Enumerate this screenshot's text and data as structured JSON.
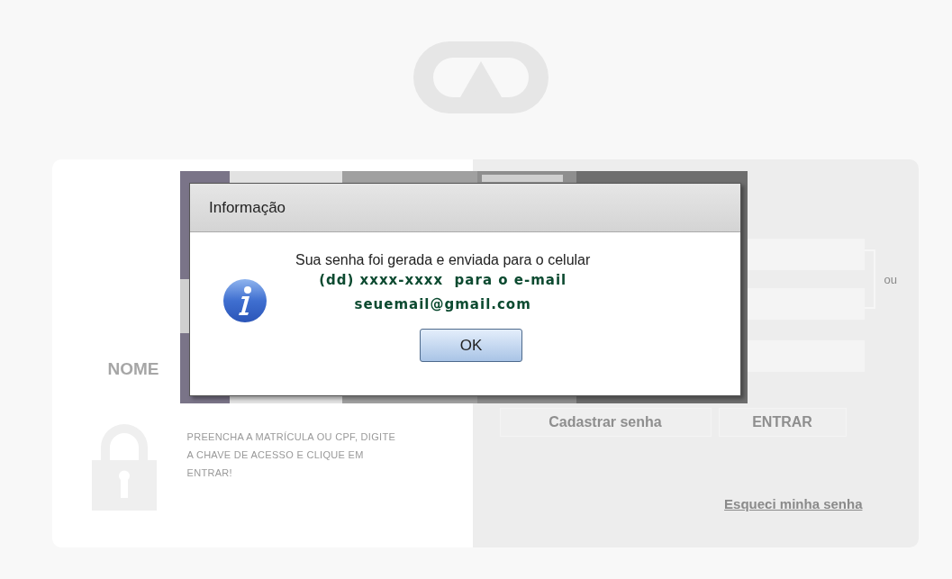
{
  "login_card": {
    "name_label": "NOME",
    "instructions": "PREENCHA A MATRÍCULA OU CPF, DIGITE A CHAVE DE ACESSO E CLIQUE EM ENTRAR!"
  },
  "form": {
    "separator": "ou",
    "buttons": [
      "Cadastrar senha",
      "ENTRAR"
    ],
    "link": "Esqueci minha senha"
  },
  "dialog": {
    "title": "Informação",
    "message": "Sua senha foi gerada e enviada para o celular",
    "details": [
      "(dd) xxxx-xxxx  para o e-mail",
      "seuemail@gmail.com"
    ],
    "button": "OK"
  }
}
